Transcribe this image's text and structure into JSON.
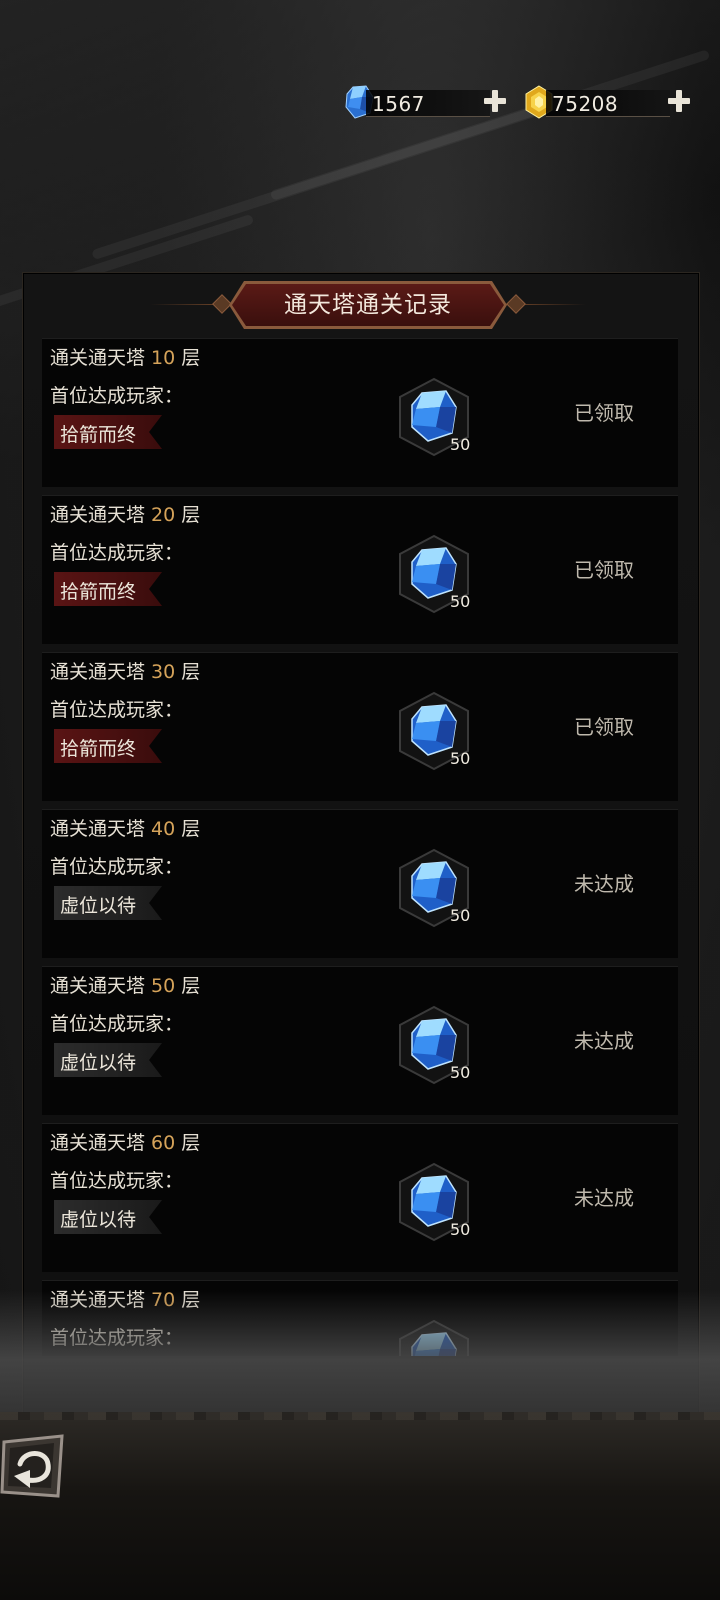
{
  "currencies": [
    {
      "name": "diamond",
      "icon": "blue-diamond-icon",
      "value": "1567"
    },
    {
      "name": "gold",
      "icon": "gold-coin-icon",
      "value": "75208"
    }
  ],
  "panel": {
    "title": "通天塔通关记录"
  },
  "records": [
    {
      "prefix": "通关通天塔 ",
      "floor": "10",
      "suffix": " 层",
      "label": "首位达成玩家：",
      "player": "拾箭而终",
      "reward_icon": "blue-diamond-icon",
      "reward_count": "50",
      "status": "已领取",
      "achieved": true
    },
    {
      "prefix": "通关通天塔 ",
      "floor": "20",
      "suffix": " 层",
      "label": "首位达成玩家：",
      "player": "拾箭而终",
      "reward_icon": "blue-diamond-icon",
      "reward_count": "50",
      "status": "已领取",
      "achieved": true
    },
    {
      "prefix": "通关通天塔 ",
      "floor": "30",
      "suffix": " 层",
      "label": "首位达成玩家：",
      "player": "拾箭而终",
      "reward_icon": "blue-diamond-icon",
      "reward_count": "50",
      "status": "已领取",
      "achieved": true
    },
    {
      "prefix": "通关通天塔 ",
      "floor": "40",
      "suffix": " 层",
      "label": "首位达成玩家：",
      "player": "虚位以待",
      "reward_icon": "blue-diamond-icon",
      "reward_count": "50",
      "status": "未达成",
      "achieved": false
    },
    {
      "prefix": "通关通天塔 ",
      "floor": "50",
      "suffix": " 层",
      "label": "首位达成玩家：",
      "player": "虚位以待",
      "reward_icon": "blue-diamond-icon",
      "reward_count": "50",
      "status": "未达成",
      "achieved": false
    },
    {
      "prefix": "通关通天塔 ",
      "floor": "60",
      "suffix": " 层",
      "label": "首位达成玩家：",
      "player": "虚位以待",
      "reward_icon": "blue-diamond-icon",
      "reward_count": "50",
      "status": "未达成",
      "achieved": false
    },
    {
      "prefix": "通关通天塔 ",
      "floor": "70",
      "suffix": " 层",
      "label": "首位达成玩家：",
      "player": "",
      "reward_icon": "blue-diamond-icon",
      "reward_count": "",
      "status": "",
      "achieved": false
    }
  ],
  "back_button": {
    "icon": "back-arrow-icon"
  },
  "colors": {
    "accent_gold": "#d5a35a",
    "title_red": "#5a1a16",
    "gem_blue": "#2f7de0"
  }
}
